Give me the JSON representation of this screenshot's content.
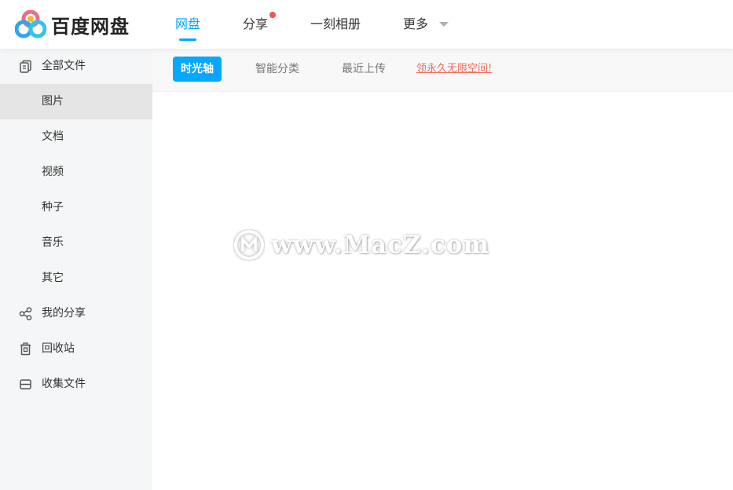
{
  "app": {
    "logo_text": "百度网盘"
  },
  "topnav": {
    "items": [
      {
        "label": "网盘",
        "active": true
      },
      {
        "label": "分享",
        "has_dot": true
      },
      {
        "label": "一刻相册"
      },
      {
        "label": "更多",
        "has_caret": true
      }
    ]
  },
  "sidebar": {
    "items": [
      {
        "label": "全部文件",
        "icon": "files-icon"
      },
      {
        "label": "图片",
        "selected": true
      },
      {
        "label": "文档"
      },
      {
        "label": "视频"
      },
      {
        "label": "种子"
      },
      {
        "label": "音乐"
      },
      {
        "label": "其它"
      },
      {
        "label": "我的分享",
        "icon": "share-icon"
      },
      {
        "label": "回收站",
        "icon": "trash-icon"
      },
      {
        "label": "收集文件",
        "icon": "inbox-icon"
      }
    ]
  },
  "subtabs": {
    "items": [
      {
        "label": "时光轴",
        "active": true
      },
      {
        "label": "智能分类"
      },
      {
        "label": "最近上传"
      }
    ],
    "promo": "领永久无限空间!"
  },
  "watermark": {
    "text": "www.MacZ.com"
  },
  "colors": {
    "accent": "#06a7ff",
    "promo": "#ef6d5a",
    "dot": "#ef5350",
    "sidebar_bg": "#f5f6f7",
    "selected_bg": "#e5e5e5"
  }
}
